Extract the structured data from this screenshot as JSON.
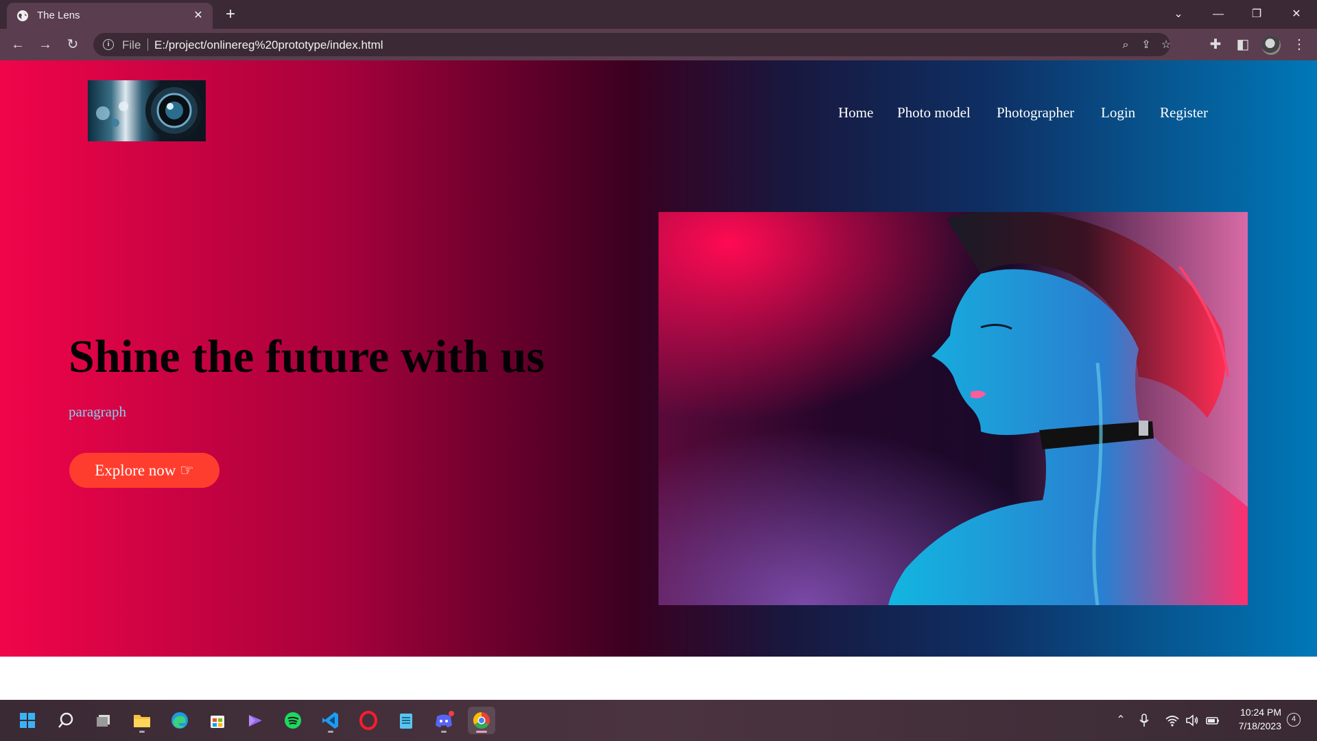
{
  "browser": {
    "tab_title": "The Lens",
    "address_scheme": "File",
    "address_url": "E:/project/onlinereg%20prototype/index.html"
  },
  "site": {
    "nav": [
      "Home",
      "Photo model",
      "Photographer",
      "Login",
      "Register"
    ],
    "hero_title": "Shine the future with us",
    "hero_paragraph": "paragraph",
    "cta_label": "Explore now ☞"
  },
  "taskbar": {
    "time": "10:24 PM",
    "date": "7/18/2023",
    "notification_count": "4",
    "apps": [
      "start",
      "search",
      "task-view",
      "file-explorer",
      "edge",
      "store",
      "clipchamp",
      "spotify",
      "vscode",
      "opera",
      "notepad",
      "discord",
      "chrome"
    ]
  },
  "colors": {
    "gradient_left": "#f0054a",
    "gradient_right": "#0078b8",
    "cta_button": "#ff3d2e",
    "paragraph": "#7fd3ef"
  }
}
